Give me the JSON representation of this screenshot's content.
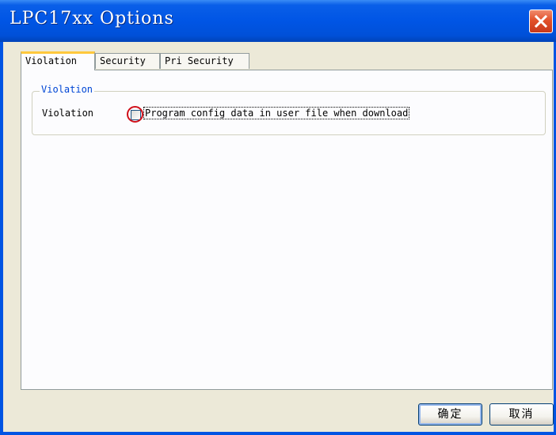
{
  "window": {
    "title": "LPC17xx Options"
  },
  "tabs": [
    {
      "label": "Violation",
      "active": true
    },
    {
      "label": "Security",
      "active": false
    },
    {
      "label": "Pri Security",
      "active": false
    }
  ],
  "violation_group": {
    "legend": "Violation",
    "row_label": "Violation",
    "checkbox": {
      "label": "Program config data in user file when download",
      "checked": false
    }
  },
  "buttons": {
    "ok_label": "确定",
    "cancel_label": "取消"
  },
  "colors": {
    "titlebar": "#0055E5",
    "dialog_background": "#ECE9D8",
    "active_tab_accent": "#FFC83C",
    "groupbox_legend": "#0046D5",
    "highlight_circle": "#D0101A"
  },
  "icons": {
    "close": "close-x-icon"
  }
}
